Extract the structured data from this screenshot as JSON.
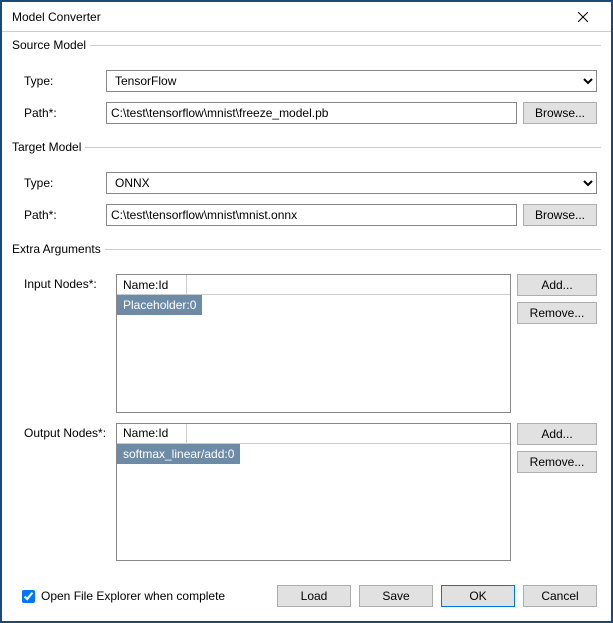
{
  "title": "Model Converter",
  "source": {
    "legend": "Source Model",
    "type_label": "Type:",
    "type_value": "TensorFlow",
    "path_label": "Path*:",
    "path_value": "C:\\test\\tensorflow\\mnist\\freeze_model.pb",
    "browse": "Browse..."
  },
  "target": {
    "legend": "Target Model",
    "type_label": "Type:",
    "type_value": "ONNX",
    "path_label": "Path*:",
    "path_value": "C:\\test\\tensorflow\\mnist\\mnist.onnx",
    "browse": "Browse..."
  },
  "extra": {
    "legend": "Extra Arguments",
    "input_nodes_label": "Input Nodes*:",
    "output_nodes_label": "Output Nodes*:",
    "header": "Name:Id",
    "input_items": [
      "Placeholder:0"
    ],
    "output_items": [
      "softmax_linear/add:0"
    ],
    "add": "Add...",
    "remove": "Remove..."
  },
  "footer": {
    "checkbox_label": "Open File Explorer when complete",
    "checkbox_checked": true,
    "load": "Load",
    "save": "Save",
    "ok": "OK",
    "cancel": "Cancel"
  }
}
